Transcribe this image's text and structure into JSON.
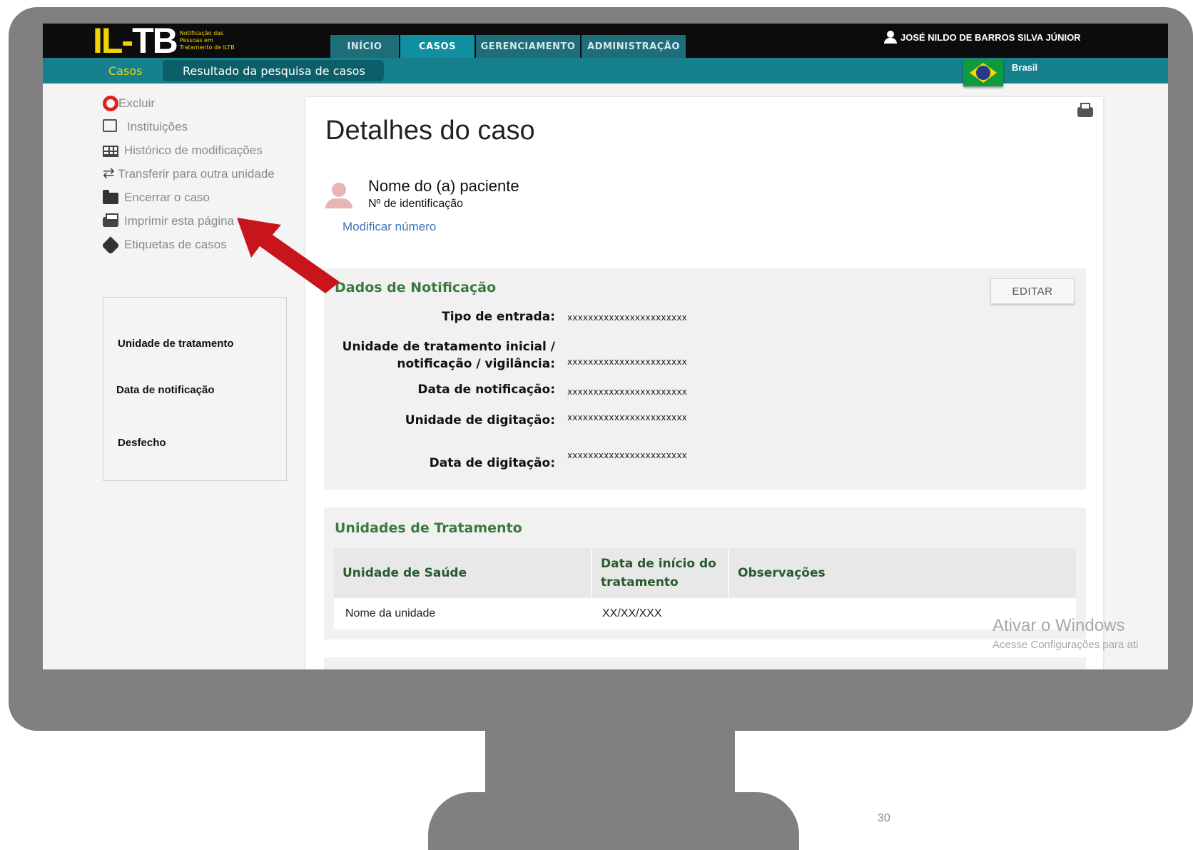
{
  "header": {
    "logo": {
      "mark_il": "IL-",
      "mark_tb": "TB",
      "tagline": [
        "Notificação das",
        "Pessoas em",
        "Tratamento de ILTB"
      ]
    },
    "nav_tabs": [
      {
        "label": "INÍCIO",
        "active": false
      },
      {
        "label": "CASOS",
        "active": true
      },
      {
        "label": "GERENCIAMENTO",
        "active": false
      },
      {
        "label": "ADMINISTRAÇÃO",
        "active": false
      }
    ],
    "user_name": "JOSÉ NILDO DE BARROS SILVA JÚNIOR",
    "user_icon": "user-icon"
  },
  "breadcrumb": {
    "root": "Casos",
    "current": "Resultado da pesquisa de casos"
  },
  "country": {
    "name": "Brasil",
    "flag_icon": "brazil-flag-icon"
  },
  "sidebar": {
    "items": [
      {
        "label": "Excluir",
        "icon": "delete-circle-icon"
      },
      {
        "label": "Instituições",
        "icon": "building-icon"
      },
      {
        "label": "Histórico de modificações",
        "icon": "table-icon"
      },
      {
        "label": "Transferir para outra unidade",
        "icon": "transfer-icon"
      },
      {
        "label": "Encerrar o caso",
        "icon": "folder-icon"
      },
      {
        "label": "Imprimir esta página",
        "icon": "print-icon"
      },
      {
        "label": "Etiquetas de casos",
        "icon": "tag-icon"
      }
    ],
    "summary": {
      "unidade_label": "Unidade de tratamento",
      "data_label": "Data de notificação",
      "desfecho_label": "Desfecho"
    }
  },
  "main": {
    "title": "Detalhes do caso",
    "patient": {
      "name": "Nome do (a) paciente",
      "id_label": "Nº de identificação",
      "modify_link": "Modificar número"
    },
    "notification": {
      "title": "Dados de Notificação",
      "edit_label": "EDITAR",
      "fields": [
        {
          "label": "Tipo de entrada:",
          "value": "xxxxxxxxxxxxxxxxxxxxxxx"
        },
        {
          "label_line1": "Unidade de tratamento inicial /",
          "label_line2": "notificação / vigilância:",
          "value": "xxxxxxxxxxxxxxxxxxxxxxx"
        },
        {
          "label": "Data de notificação:",
          "value": "xxxxxxxxxxxxxxxxxxxxxxx"
        },
        {
          "label": "Unidade de digitação:",
          "value": "xxxxxxxxxxxxxxxxxxxxxxx"
        },
        {
          "label": "Data de digitação:",
          "value": "xxxxxxxxxxxxxxxxxxxxxxx"
        }
      ]
    },
    "treatment_units": {
      "title": "Unidades de Tratamento",
      "columns": [
        "Unidade de Saúde",
        "Data de início do tratamento",
        "Observações"
      ],
      "rows": [
        {
          "unit": "Nome da unidade",
          "start_date": "XX/XX/XXX",
          "notes": ""
        }
      ]
    }
  },
  "watermark": {
    "line1": "Ativar o Windows",
    "line2": "Acesse Configurações para ati"
  },
  "page_number": "30",
  "colors": {
    "topbar": "#0c0c0c",
    "teal": "#17808d",
    "accent_yellow": "#f0d300",
    "section_title_green": "#3a7a3f",
    "link_blue": "#3c77b8",
    "arrow_red": "#c8141b"
  }
}
